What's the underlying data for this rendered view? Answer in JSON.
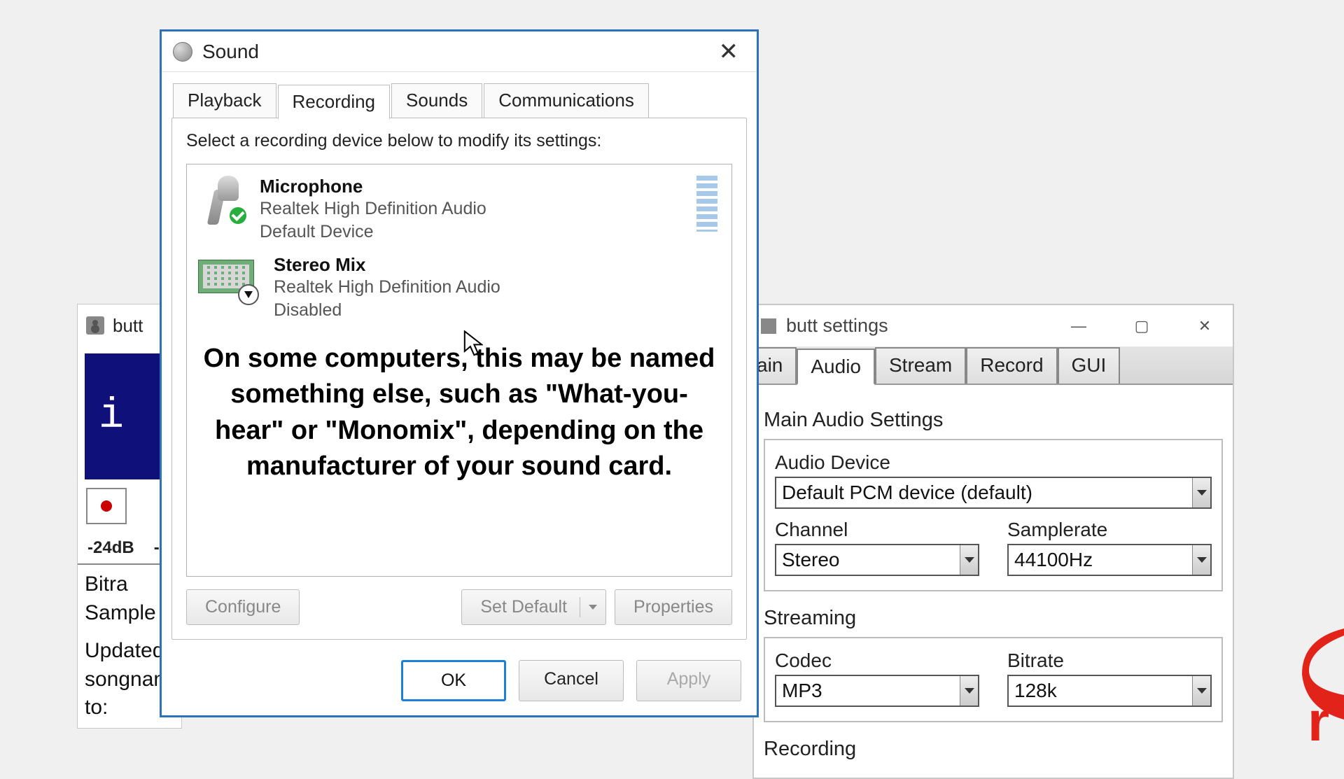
{
  "butt_main": {
    "title": "butt",
    "display": "i",
    "db_label": "-24dB",
    "db_dash": "-",
    "log_line1": "Bitra",
    "log_line2": "Sample",
    "log_line3": "Updated songname to:"
  },
  "butt_settings": {
    "title": "butt settings",
    "tabs": {
      "main_partial": "ain",
      "audio": "Audio",
      "stream": "Stream",
      "record": "Record",
      "gui": "GUI"
    },
    "main_audio_title": "Main Audio Settings",
    "audio_device_label": "Audio Device",
    "audio_device_value": "Default PCM device (default)",
    "channel_label": "Channel",
    "channel_value": "Stereo",
    "samplerate_label": "Samplerate",
    "samplerate_value": "44100Hz",
    "streaming_title": "Streaming",
    "codec_label": "Codec",
    "codec_value": "MP3",
    "bitrate_label": "Bitrate",
    "bitrate_value": "128k",
    "recording_title": "Recording"
  },
  "sound": {
    "title": "Sound",
    "tabs": {
      "playback": "Playback",
      "recording": "Recording",
      "sounds": "Sounds",
      "communications": "Communications"
    },
    "instruction": "Select a recording device below to modify its settings:",
    "devices": [
      {
        "name": "Microphone",
        "driver": "Realtek High Definition Audio",
        "status": "Default Device"
      },
      {
        "name": "Stereo Mix",
        "driver": "Realtek High Definition Audio",
        "status": "Disabled"
      }
    ],
    "overlay_text": "On some computers, this may be named something else, such as \"What-you-hear\" or \"Monomix\", depending on the manufacturer of your sound card.",
    "buttons": {
      "configure": "Configure",
      "set_default": "Set Default",
      "properties": "Properties",
      "ok": "OK",
      "cancel": "Cancel",
      "apply": "Apply"
    }
  },
  "colors": {
    "dialog_border": "#2c72b8",
    "green_check": "#27ae3c"
  }
}
